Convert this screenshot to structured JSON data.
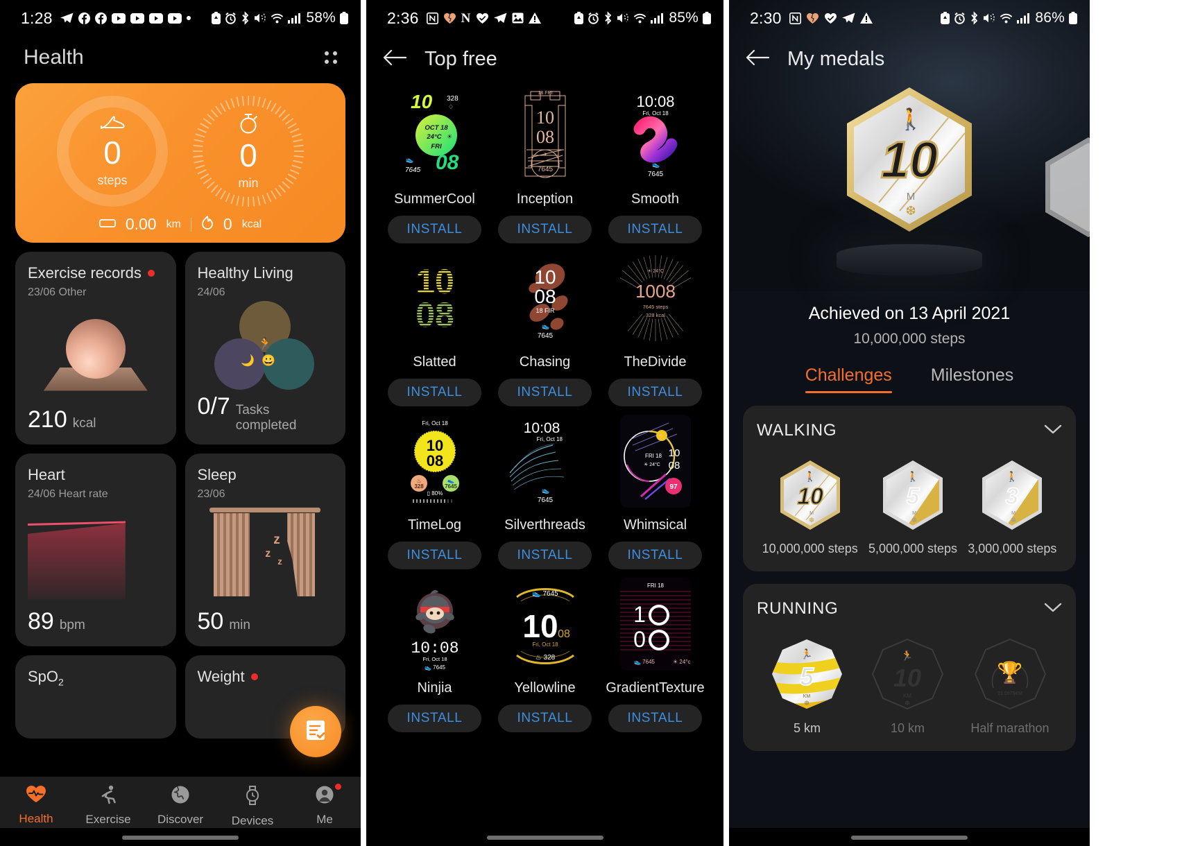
{
  "panel1": {
    "statusbar": {
      "time": "1:28",
      "left_icons": [
        "telegram-icon",
        "facebook-icon",
        "facebook-icon",
        "youtube-icon",
        "youtube-icon",
        "youtube-icon",
        "youtube-icon",
        "dot-icon"
      ],
      "right_icons": [
        "battery-saver-icon",
        "alarm-icon",
        "bluetooth-icon",
        "mute-icon",
        "wifi-icon",
        "signal-icon"
      ],
      "battery": "58%"
    },
    "appbar": {
      "title": "Health",
      "menu_icon": "grid-menu-icon"
    },
    "hero": {
      "steps_value": "0",
      "steps_label": "steps",
      "steps_icon": "shoe-icon",
      "minutes_value": "0",
      "minutes_label": "min",
      "minutes_icon": "stopwatch-icon",
      "distance_value": "0.00",
      "distance_unit": "km",
      "distance_icon": "distance-icon",
      "calories_value": "0",
      "calories_unit": "kcal",
      "calories_icon": "flame-icon",
      "accent": "#f68a23"
    },
    "cards": [
      {
        "title": "Exercise records",
        "has_badge": true,
        "sub": "23/06  Other",
        "value": "210",
        "unit": "kcal",
        "art": "ball-on-plinth"
      },
      {
        "title": "Healthy Living",
        "has_badge": false,
        "sub": "24/06",
        "value": "0/7",
        "unit": "Tasks completed",
        "art": "three-blobs"
      },
      {
        "title": "Heart",
        "has_badge": false,
        "sub": "24/06  Heart rate",
        "value": "89",
        "unit": "bpm",
        "art": "heart-rate-chart"
      },
      {
        "title": "Sleep",
        "has_badge": false,
        "sub": "23/06",
        "value": "50",
        "unit": "min",
        "art": "curtain"
      }
    ],
    "partial_cards": [
      {
        "title": "SpO",
        "sub_script": "2",
        "has_badge": false
      },
      {
        "title": "Weight",
        "has_badge": true
      }
    ],
    "fab": {
      "icon": "notes-checklist-icon"
    },
    "bottomnav": [
      {
        "label": "Health",
        "icon": "heart-pulse-icon",
        "active": true,
        "badge": false
      },
      {
        "label": "Exercise",
        "icon": "runner-icon",
        "active": false,
        "badge": false
      },
      {
        "label": "Discover",
        "icon": "globe-icon",
        "active": false,
        "badge": false
      },
      {
        "label": "Devices",
        "icon": "watch-icon",
        "active": false,
        "badge": false
      },
      {
        "label": "Me",
        "icon": "person-icon",
        "active": false,
        "badge": true
      }
    ]
  },
  "panel2": {
    "statusbar": {
      "time": "2:36",
      "left_icons": [
        "notion-icon",
        "heart-broken-icon",
        "n-letter-icon",
        "heart-icon",
        "telegram-icon",
        "photo-icon",
        "warning-icon"
      ],
      "right_icons": [
        "battery-saver-icon",
        "alarm-icon",
        "bluetooth-icon",
        "mute-icon",
        "wifi-icon",
        "signal-icon"
      ],
      "battery": "85%"
    },
    "appbar": {
      "back_icon": "arrow-left-icon",
      "title": "Top free"
    },
    "install_label": "INSTALL",
    "watchfaces": [
      {
        "name": "SummerCool",
        "art": "summercool",
        "time": "1008",
        "date": "OCT 18",
        "temp": "24°C",
        "day": "FRI",
        "steps": "7645",
        "kcal": "328"
      },
      {
        "name": "Inception",
        "art": "inception",
        "time": "10 08",
        "date": "18 FRI",
        "steps": "7645"
      },
      {
        "name": "Smooth",
        "art": "smooth",
        "time": "10:08",
        "date": "Fri, Oct 18",
        "steps": "7645"
      },
      {
        "name": "Slatted",
        "art": "slatted",
        "time": "1008"
      },
      {
        "name": "Chasing",
        "art": "chasing",
        "time": "10 08",
        "date": "18 FIR",
        "steps": "7645"
      },
      {
        "name": "TheDivide",
        "art": "thedivide",
        "time": "1008",
        "temp": "24°C",
        "steps": "7645 steps",
        "kcal": "328 kcal"
      },
      {
        "name": "TimeLog",
        "art": "timelog",
        "time": "1008",
        "date": "Fri, Oct 18",
        "steps": "7645",
        "kcal": "328",
        "battery": "80%"
      },
      {
        "name": "Silverthreads",
        "art": "silverthreads",
        "time": "10:08",
        "date": "Fri, Oct 18",
        "steps": "7645"
      },
      {
        "name": "Whimsical",
        "art": "whimsical",
        "time": "10 08",
        "date": "FRI 18",
        "temp": "24°C",
        "hr": "97"
      },
      {
        "name": "Ninjia",
        "art": "ninjia",
        "time": "10:08",
        "date": "Fri, Oct 18",
        "steps": "7645"
      },
      {
        "name": "Yellowline",
        "art": "yellowline",
        "time": "10",
        "time2": "08",
        "date": "Fri, Oct 18",
        "steps": "7645",
        "kcal": "328"
      },
      {
        "name": "GradientTexture",
        "art": "gradienttexture",
        "time": "1008",
        "date": "FRI 18",
        "steps": "7645",
        "temp": "24°c"
      }
    ]
  },
  "panel3": {
    "statusbar": {
      "time": "2:30",
      "left_icons": [
        "notion-icon",
        "heart-broken-icon",
        "heart-icon",
        "telegram-icon",
        "warning-icon"
      ],
      "right_icons": [
        "battery-saver-icon",
        "alarm-icon",
        "bluetooth-icon",
        "mute-icon",
        "wifi-icon",
        "signal-icon"
      ],
      "battery": "86%"
    },
    "appbar": {
      "back_icon": "arrow-left-icon",
      "title": "My medals"
    },
    "featured_medal": {
      "number": "10",
      "suffix": "M",
      "icon": "walking-icon"
    },
    "achieved_on": "Achieved on 13 April 2021",
    "achieved_detail": "10,000,000 steps",
    "tabs": [
      {
        "label": "Challenges",
        "active": true
      },
      {
        "label": "Milestones",
        "active": false
      }
    ],
    "accent": "#f4702a",
    "sections": [
      {
        "title": "WALKING",
        "chevron_icon": "chevron-down-icon",
        "medals": [
          {
            "number": "10",
            "suffix": "M",
            "caption": "10,000,000 steps",
            "style": "gold-outline",
            "locked": false,
            "icon": "walking-icon"
          },
          {
            "number": "5",
            "suffix": "M",
            "caption": "5,000,000 steps",
            "style": "gold-stripe",
            "locked": false,
            "icon": "walking-icon"
          },
          {
            "number": "3",
            "suffix": "M",
            "caption": "3,000,000 steps",
            "style": "gold-stripe",
            "locked": false,
            "icon": "walking-icon"
          }
        ]
      },
      {
        "title": "RUNNING",
        "chevron_icon": "chevron-down-icon",
        "medals": [
          {
            "number": "5",
            "suffix": "KM",
            "caption": "5 km",
            "style": "yellow-bands",
            "locked": false,
            "icon": "running-icon"
          },
          {
            "number": "10",
            "suffix": "KM",
            "caption": "10 km",
            "style": "locked",
            "locked": true,
            "icon": "running-icon"
          },
          {
            "number": "",
            "suffix": "",
            "caption": "Half marathon",
            "style": "locked",
            "locked": true,
            "icon": "trophy-icon"
          }
        ]
      }
    ]
  }
}
